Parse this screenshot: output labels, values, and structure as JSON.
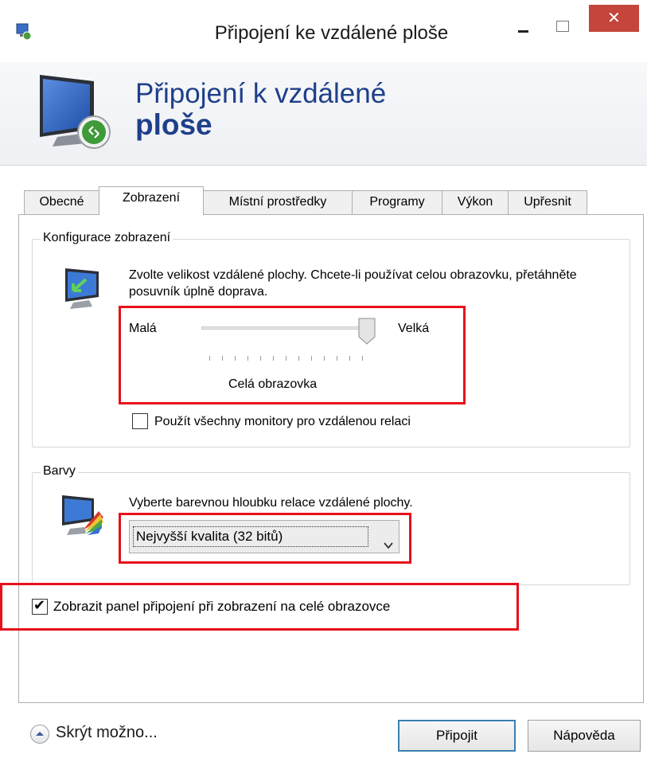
{
  "window": {
    "title": "Připojení ke vzdálené ploše",
    "close_glyph": "✕"
  },
  "banner": {
    "title_line1": "Připojení k vzdálené",
    "title_line2": "ploše"
  },
  "tabs": [
    {
      "label": "Obecné",
      "active": false
    },
    {
      "label": "Zobrazení",
      "active": true
    },
    {
      "label": "Místní prostředky",
      "active": false
    },
    {
      "label": "Programy",
      "active": false
    },
    {
      "label": "Výkon",
      "active": false
    },
    {
      "label": "Upřesnit",
      "active": false
    }
  ],
  "display_config": {
    "group_label": "Konfigurace zobrazení",
    "description": "Zvolte velikost vzdálené plochy. Chcete-li používat celou obrazovku, přetáhněte posuvník úplně doprava.",
    "slider_min_label": "Malá",
    "slider_max_label": "Velká",
    "slider_value": 1.0,
    "slider_value_label": "Celá obrazovka",
    "all_monitors_label": "Použít všechny monitory pro vzdálenou relaci",
    "all_monitors_checked": false
  },
  "colors": {
    "group_label": "Barvy",
    "description": "Vyberte barevnou hloubku relace vzdálené plochy.",
    "selected_depth": "Nejvyšší kvalita (32 bitů)"
  },
  "connection_bar": {
    "label": "Zobrazit panel připojení při zobrazení na celé obrazovce",
    "checked": true
  },
  "footer": {
    "options_label": "Skrýt možno...",
    "connect_label": "Připojit",
    "help_label": "Nápověda"
  },
  "colors_theme": {
    "close_button": "#c4453c",
    "banner_title": "#1e3f8a",
    "highlight_border": "#e8101a"
  }
}
